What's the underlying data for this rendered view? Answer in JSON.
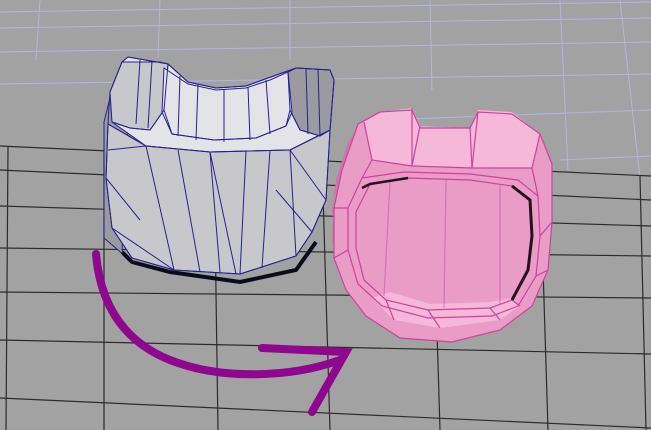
{
  "viewport": {
    "background_color": "#a2a2a2",
    "far_grid_color": "#b4b4e6",
    "near_grid_color": "#2b2b2b"
  },
  "left_model": {
    "state": "unselected",
    "wire_color": "#23238e",
    "shade_light": "#e4e4e8",
    "shade_mid": "#c8c8cc",
    "shade_dark": "#9a9aa0"
  },
  "right_model": {
    "state": "selected",
    "wire_color": "#d040a0",
    "shade_light": "#f6b8d8",
    "shade_mid": "#e89cc6",
    "shade_dark": "#c978a8"
  },
  "annotation_arrow": {
    "color": "#8e078e",
    "direction": "left-model-to-right-model"
  }
}
